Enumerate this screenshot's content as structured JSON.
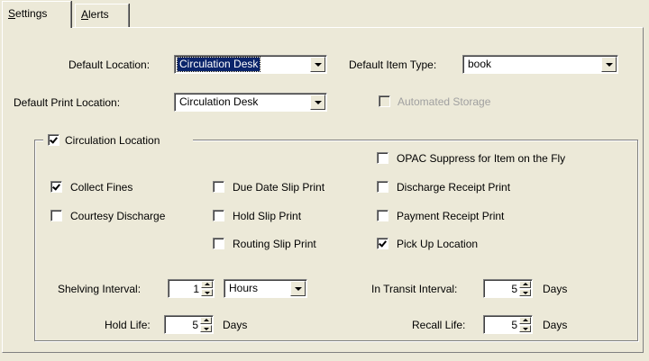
{
  "tabs": [
    {
      "label": "Settings",
      "accel": "S",
      "rest": "ettings",
      "active": true
    },
    {
      "label": "Alerts",
      "accel": "A",
      "rest": "lerts",
      "active": false
    }
  ],
  "settings": {
    "default_location": {
      "label": "Default Location:",
      "value": "Circulation Desk"
    },
    "default_item_type": {
      "label": "Default Item Type:",
      "value": "book"
    },
    "default_print_location": {
      "label": "Default Print Location:",
      "value": "Circulation Desk"
    },
    "automated_storage": {
      "label": "Automated Storage",
      "checked": false,
      "enabled": false
    },
    "circulation_location": {
      "label": "Circulation Location",
      "checked": true
    },
    "options": {
      "opac_suppress": {
        "label": "OPAC Suppress for Item on the Fly",
        "checked": false
      },
      "collect_fines": {
        "label": "Collect Fines",
        "checked": true
      },
      "due_date_slip_print": {
        "label": "Due Date Slip Print",
        "checked": false
      },
      "discharge_receipt_print": {
        "label": "Discharge Receipt Print",
        "checked": false
      },
      "courtesy_discharge": {
        "label": "Courtesy Discharge",
        "checked": false
      },
      "hold_slip_print": {
        "label": "Hold Slip Print",
        "checked": false
      },
      "payment_receipt_print": {
        "label": "Payment Receipt Print",
        "checked": false
      },
      "routing_slip_print": {
        "label": "Routing Slip Print",
        "checked": false
      },
      "pick_up_location": {
        "label": "Pick Up Location",
        "checked": true
      }
    },
    "shelving_interval": {
      "label": "Shelving Interval:",
      "value": "1",
      "unit": "Hours"
    },
    "in_transit_interval": {
      "label": "In Transit Interval:",
      "value": "5",
      "unit": "Days"
    },
    "hold_life": {
      "label": "Hold Life:",
      "value": "5",
      "unit": "Days"
    },
    "recall_life": {
      "label": "Recall Life:",
      "value": "5",
      "unit": "Days"
    }
  },
  "colors": {
    "window_bg": "#ece9d8",
    "selection": "#0a246a"
  }
}
